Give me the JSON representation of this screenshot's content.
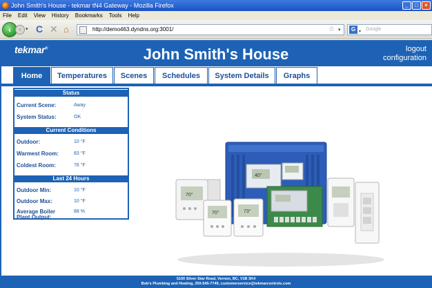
{
  "window": {
    "title": "John Smith's House - tekmar tN4 Gateway - Mozilla Firefox"
  },
  "menu": [
    "File",
    "Edit",
    "View",
    "History",
    "Bookmarks",
    "Tools",
    "Help"
  ],
  "browser": {
    "url": "http://demo463.dyndns.org:3001/",
    "search_placeholder": "Google"
  },
  "header": {
    "logo": "tekmar",
    "title": "John Smith's House",
    "logout": "logout",
    "configuration": "configuration"
  },
  "tabs": [
    "Home",
    "Temperatures",
    "Scenes",
    "Schedules",
    "System Details",
    "Graphs"
  ],
  "active_tab": "Home",
  "status": {
    "heading": "Status",
    "current_scene_label": "Current Scene:",
    "current_scene_value": "Away",
    "system_status_label": "System Status:",
    "system_status_value": "OK"
  },
  "conditions": {
    "heading": "Current Conditions",
    "outdoor_label": "Outdoor:",
    "outdoor_value": "10 °F",
    "warmest_label": "Warmest Room:",
    "warmest_value": "83 °F",
    "coldest_label": "Coldest Room:",
    "coldest_value": "76 °F"
  },
  "last24": {
    "heading": "Last 24 Hours",
    "outdoor_min_label": "Outdoor Min:",
    "outdoor_min_value": "10 °F",
    "outdoor_max_label": "Outdoor Max:",
    "outdoor_max_value": "10 °F",
    "boiler_label_1": "Average Boiler",
    "boiler_label_2": "Plant Output:",
    "boiler_value": "88 %"
  },
  "footer": {
    "line1": "5100 Silver Star Road, Vernon, BC, V1B 3K4",
    "line2": "Bob's Plumbing and Heating, 250-545-7749, customerservice@tekmarcontrols.com"
  },
  "colors": {
    "brand_blue": "#1d62b4"
  }
}
